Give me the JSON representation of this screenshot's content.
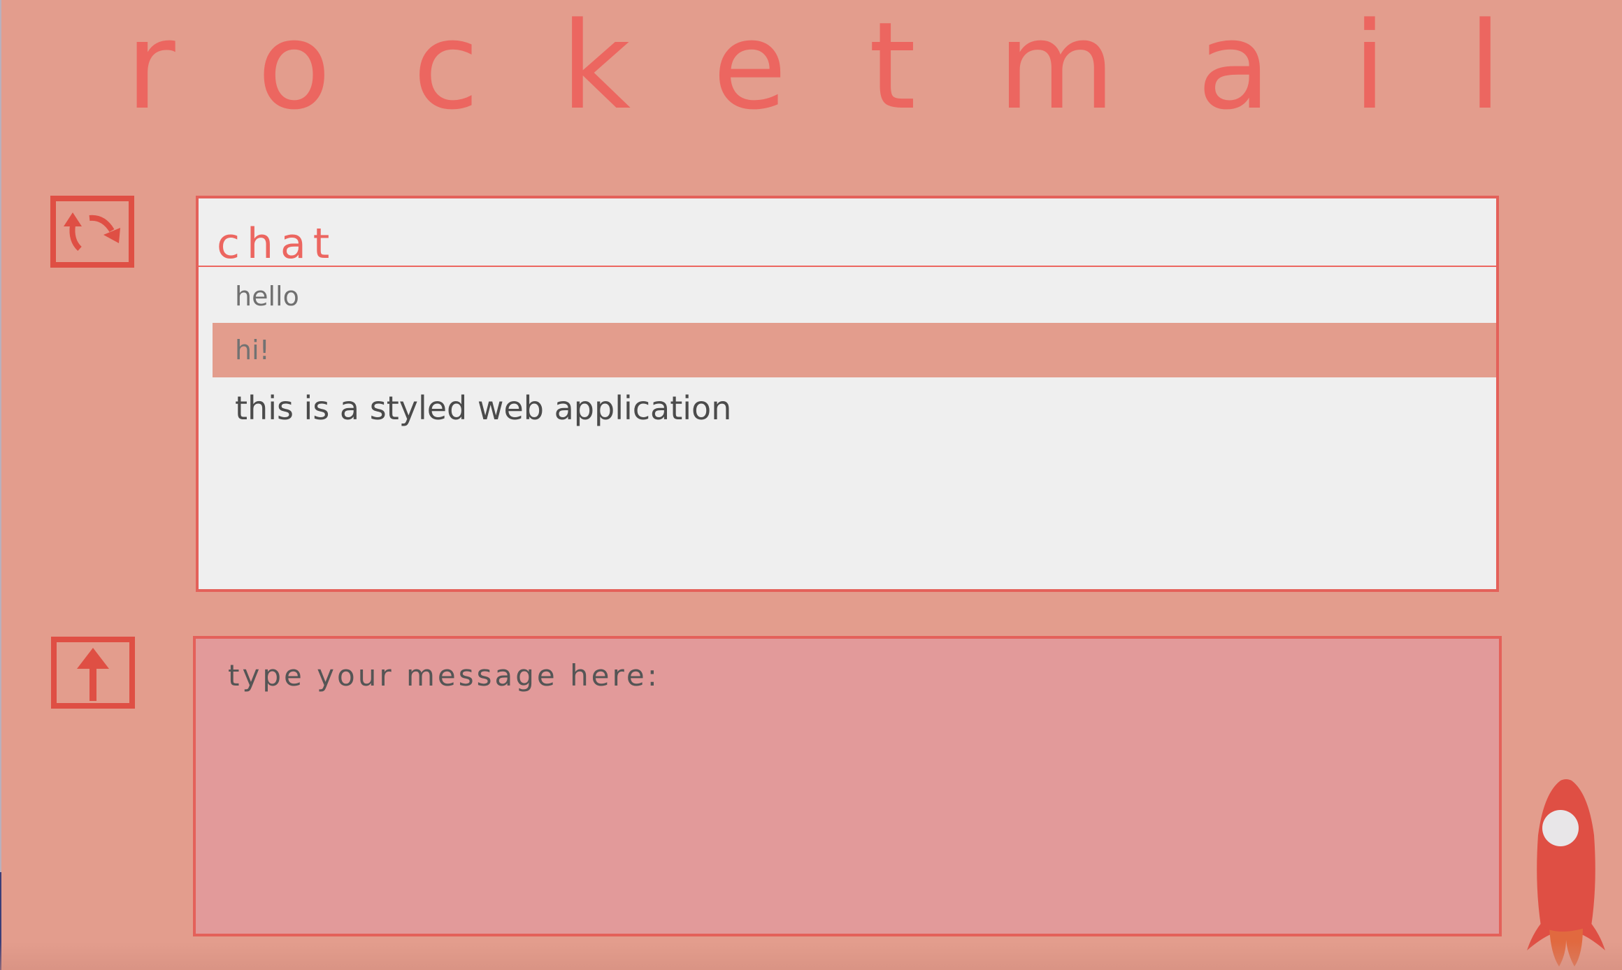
{
  "app": {
    "logo_letters": [
      "r",
      "o",
      "c",
      "k",
      "e",
      "t",
      "m",
      "a",
      "i",
      "l"
    ]
  },
  "icons": {
    "refresh": "refresh-icon",
    "upload": "upload-arrow-icon",
    "rocket": "rocket-icon"
  },
  "chat": {
    "title": "chat",
    "messages": [
      {
        "text": "hello"
      },
      {
        "text": "hi!"
      },
      {
        "text": "this is a styled web application"
      }
    ]
  },
  "compose": {
    "placeholder": "type your message here:",
    "value": ""
  },
  "colors": {
    "background": "#e39d8d",
    "accent": "#ec6660",
    "icon_red": "#df4f44",
    "panel": "#efefef",
    "highlight_row": "#e39d8d",
    "compose_bg": "#e29a9a"
  }
}
